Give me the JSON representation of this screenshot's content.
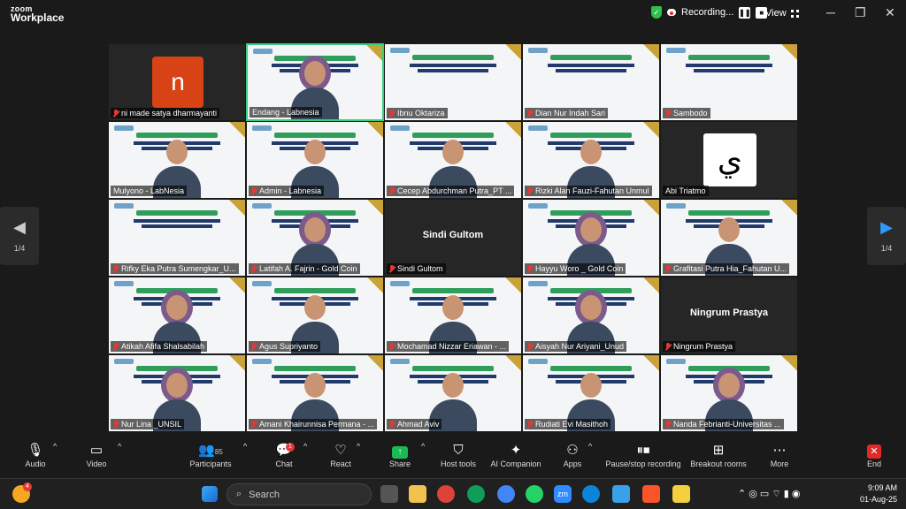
{
  "app": {
    "logo_line1": "zoom",
    "logo_line2": "Workplace"
  },
  "titlebar": {
    "recording_label": "Recording...",
    "view_label": "View",
    "pause_glyph": "❚❚",
    "stop_glyph": "■"
  },
  "window": {
    "minimize": "─",
    "restore": "❐",
    "close": "✕"
  },
  "pager": {
    "left_arrow": "◀",
    "left_page": "1/4",
    "right_arrow": "▶",
    "right_page": "1/4"
  },
  "participants": [
    {
      "name": "ni made satya dharmayanti",
      "kind": "avatar",
      "avatar_letter": "n",
      "muted": true
    },
    {
      "name": "Endang - Labnesia",
      "kind": "video-hijab",
      "muted": false,
      "active": true,
      "slide_text": "SELAMAT D"
    },
    {
      "name": "Ibnu Oktariza",
      "kind": "slide",
      "muted": true
    },
    {
      "name": "Dian Nur Indah Sari",
      "kind": "slide",
      "muted": true
    },
    {
      "name": "Sambodo",
      "kind": "slide",
      "muted": true
    },
    {
      "name": "Mulyono - LabNesia",
      "kind": "video",
      "muted": false
    },
    {
      "name": "Admin - Labnesia",
      "kind": "video",
      "muted": true
    },
    {
      "name": "Cecep Abdurchman Putra_PT ...",
      "kind": "video",
      "muted": true
    },
    {
      "name": "Rizki Alan Fauzi-Fahutan Unmul",
      "kind": "video",
      "muted": true
    },
    {
      "name": "Abi Triatmo",
      "kind": "avatar-ar",
      "avatar_letter": "ي",
      "muted": false
    },
    {
      "name": "Rifky Eka Putra Sumengkar_U...",
      "kind": "slide",
      "muted": true
    },
    {
      "name": "Latifah A. Fajrin - Gold Coin",
      "kind": "video-hijab",
      "muted": true
    },
    {
      "name": "Sindi Gultom",
      "kind": "name",
      "display_name": "Sindi Gultom",
      "muted": true
    },
    {
      "name": "Hayyu Woro _ Gold Coin",
      "kind": "video-hijab",
      "muted": true
    },
    {
      "name": "Grafitasi Putra Hia_Fahutan U...",
      "kind": "video",
      "muted": true
    },
    {
      "name": "Atikah Afifa Shalsabilah",
      "kind": "video-hijab",
      "muted": true
    },
    {
      "name": "Agus Supriyanto",
      "kind": "video",
      "muted": true
    },
    {
      "name": "Mochamad Nizzar Eriawan - ...",
      "kind": "video",
      "muted": true
    },
    {
      "name": "Aisyah Nur Ariyani_Unud",
      "kind": "video-hijab",
      "muted": true
    },
    {
      "name": "Ningrum Prastya",
      "kind": "name",
      "display_name": "Ningrum Prastya",
      "muted": true
    },
    {
      "name": "Nur Lina _UNSIL",
      "kind": "video-hijab",
      "muted": true
    },
    {
      "name": "Amani Khairunnisa Permana - ...",
      "kind": "video",
      "muted": true
    },
    {
      "name": "Ahmad Aviv",
      "kind": "video",
      "muted": true
    },
    {
      "name": "Rudiati Evi Masithoh",
      "kind": "video",
      "muted": true
    },
    {
      "name": "Nanda Febrianti-Universitas ...",
      "kind": "video-hijab",
      "muted": true
    }
  ],
  "toolbar": {
    "audio": "Audio",
    "video": "Video",
    "participants": "Participants",
    "participants_count": "85",
    "chat": "Chat",
    "chat_badge": "1",
    "react": "React",
    "share": "Share",
    "host_tools": "Host tools",
    "ai_companion": "AI Companion",
    "apps": "Apps",
    "pause_stop": "Pause/stop recording",
    "breakout": "Breakout rooms",
    "more": "More",
    "end": "End",
    "caret": "^"
  },
  "taskbar": {
    "search_placeholder": "Search",
    "weather_badge": "4",
    "time": "9:09 AM",
    "date": "01-Aug-25"
  },
  "colors": {
    "active_border": "#35d07f",
    "muted_red": "#e53935",
    "share_green": "#1db954",
    "end_red": "#e02a2a"
  }
}
